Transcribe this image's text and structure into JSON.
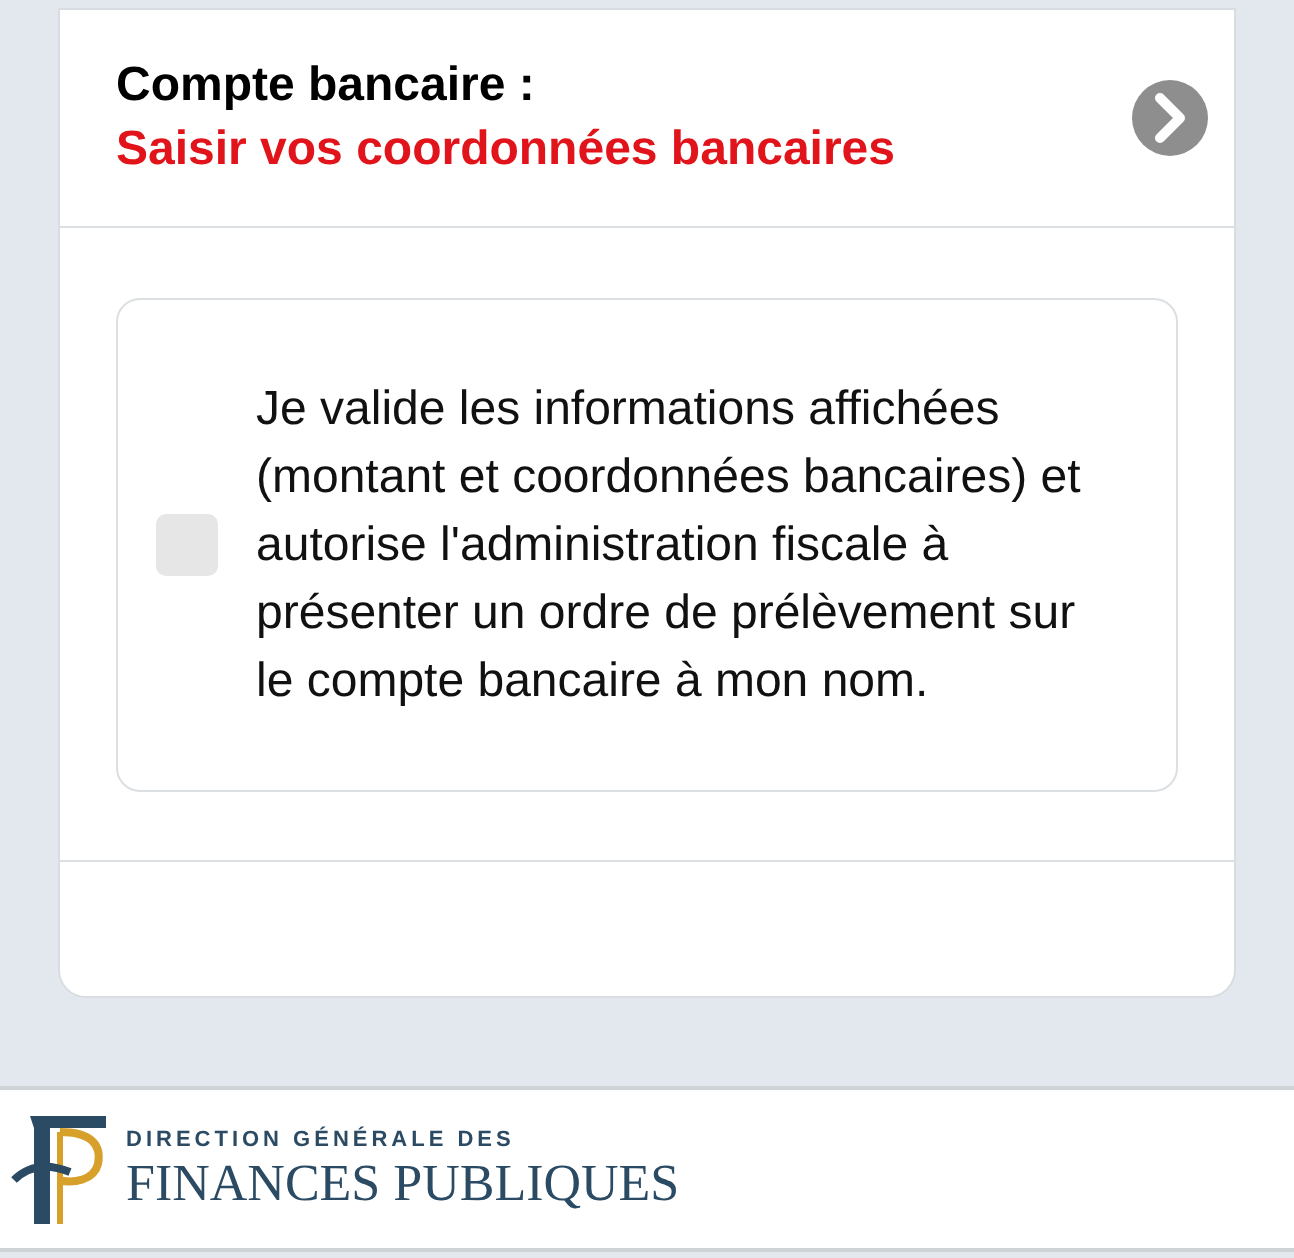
{
  "account_row": {
    "label": "Compte bancaire :",
    "action": "Saisir vos coordonnées bancaires"
  },
  "consent": {
    "checked": false,
    "text": "Je valide les informations affichées (montant et coordonnées bancaires) et autorise l'administration fiscale à présenter un ordre de prélèvement sur le compte bancaire à mon nom."
  },
  "footer": {
    "logo_line_1": "DIRECTION GÉNÉRALE DES",
    "logo_line_2": "FINANCES PUBLIQUES"
  }
}
